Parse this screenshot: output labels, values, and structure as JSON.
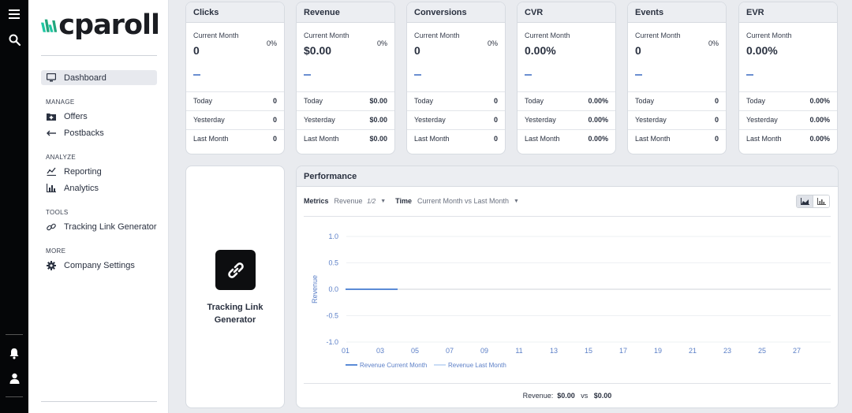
{
  "sidebar": {
    "logo_text": "cparoll",
    "dashboard": "Dashboard",
    "sections": [
      {
        "title": "MANAGE",
        "items": [
          "Offers",
          "Postbacks"
        ]
      },
      {
        "title": "ANALYZE",
        "items": [
          "Reporting",
          "Analytics"
        ]
      },
      {
        "title": "TOOLS",
        "items": [
          "Tracking Link Generator"
        ]
      },
      {
        "title": "MORE",
        "items": [
          "Company Settings"
        ]
      }
    ]
  },
  "cards": [
    {
      "title": "Clicks",
      "current_label": "Current Month",
      "current_value": "0",
      "change": "0%",
      "today_label": "Today",
      "today": "0",
      "yesterday_label": "Yesterday",
      "yesterday": "0",
      "last_month_label": "Last Month",
      "last_month": "0"
    },
    {
      "title": "Revenue",
      "current_label": "Current Month",
      "current_value": "$0.00",
      "change": "0%",
      "today_label": "Today",
      "today": "$0.00",
      "yesterday_label": "Yesterday",
      "yesterday": "$0.00",
      "last_month_label": "Last Month",
      "last_month": "$0.00"
    },
    {
      "title": "Conversions",
      "current_label": "Current Month",
      "current_value": "0",
      "change": "0%",
      "today_label": "Today",
      "today": "0",
      "yesterday_label": "Yesterday",
      "yesterday": "0",
      "last_month_label": "Last Month",
      "last_month": "0"
    },
    {
      "title": "CVR",
      "current_label": "Current Month",
      "current_value": "0.00%",
      "change": "",
      "today_label": "Today",
      "today": "0.00%",
      "yesterday_label": "Yesterday",
      "yesterday": "0.00%",
      "last_month_label": "Last Month",
      "last_month": "0.00%"
    },
    {
      "title": "Events",
      "current_label": "Current Month",
      "current_value": "0",
      "change": "0%",
      "today_label": "Today",
      "today": "0",
      "yesterday_label": "Yesterday",
      "yesterday": "0",
      "last_month_label": "Last Month",
      "last_month": "0"
    },
    {
      "title": "EVR",
      "current_label": "Current Month",
      "current_value": "0.00%",
      "change": "",
      "today_label": "Today",
      "today": "0.00%",
      "yesterday_label": "Yesterday",
      "yesterday": "0.00%",
      "last_month_label": "Last Month",
      "last_month": "0.00%"
    }
  ],
  "tracking_link": {
    "line1": "Tracking Link",
    "line2": "Generator"
  },
  "performance": {
    "title": "Performance",
    "metrics_label": "Metrics",
    "metrics_value": "Revenue",
    "metrics_page": "1/2",
    "time_label": "Time",
    "time_value": "Current Month vs Last Month",
    "footer_label": "Revenue:",
    "footer_current": "$0.00",
    "footer_vs": "vs",
    "footer_last": "$0.00"
  },
  "chart_data": {
    "type": "line",
    "ylabel": "Revenue",
    "ylim": [
      -1.0,
      1.0
    ],
    "y_ticks": [
      "1.0",
      "0.5",
      "0.0",
      "-0.5",
      "-1.0"
    ],
    "x_ticks": [
      "01",
      "03",
      "05",
      "07",
      "09",
      "11",
      "13",
      "15",
      "17",
      "19",
      "21",
      "23",
      "25",
      "27"
    ],
    "series": [
      {
        "name": "Revenue Current Month",
        "color": "#5b8bd6",
        "x": [
          "01",
          "02",
          "03",
          "04"
        ],
        "values": [
          0,
          0,
          0,
          0
        ]
      },
      {
        "name": "Revenue Last Month",
        "color": "#c9dcf5",
        "x": [],
        "values": []
      }
    ],
    "grid": true,
    "legend": "bottom"
  }
}
